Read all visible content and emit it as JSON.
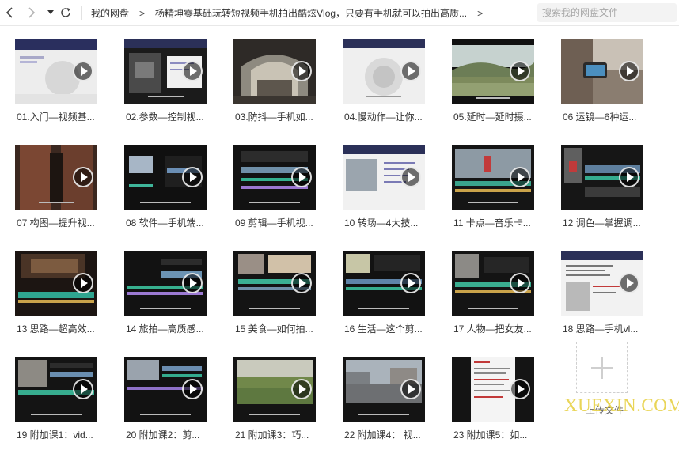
{
  "toolbar": {
    "back_icon": "chevron-left-icon",
    "forward_icon": "chevron-right-icon",
    "history_icon": "caret-down-icon",
    "refresh_icon": "refresh-icon"
  },
  "breadcrumb": {
    "root": "我的网盘",
    "separator": ">",
    "current": "杨精坤零基础玩转短视频手机拍出酷炫Vlog，只要有手机就可以拍出高质...",
    "trailing": ">"
  },
  "search": {
    "placeholder": "搜索我的网盘文件"
  },
  "files": [
    {
      "name": "01.入门—视频基..."
    },
    {
      "name": "02.参数—控制视..."
    },
    {
      "name": "03.防抖—手机如..."
    },
    {
      "name": "04.慢动作—让你..."
    },
    {
      "name": "05.延时—延时摄..."
    },
    {
      "name": "06 运镜—6种运..."
    },
    {
      "name": "07 构图—提升视..."
    },
    {
      "name": "08 软件—手机端..."
    },
    {
      "name": "09 剪辑—手机视..."
    },
    {
      "name": "10 转场—4大技..."
    },
    {
      "name": "11 卡点—音乐卡..."
    },
    {
      "name": "12 调色—掌握调..."
    },
    {
      "name": "13 思路—超高效..."
    },
    {
      "name": "14 旅拍—高质感..."
    },
    {
      "name": "15 美食—如何拍..."
    },
    {
      "name": "16 生活—这个剪..."
    },
    {
      "name": "17 人物—把女友..."
    },
    {
      "name": "18 思路—手机vl..."
    },
    {
      "name": "19 附加课1：vid..."
    },
    {
      "name": "20 附加课2：剪..."
    },
    {
      "name": "21 附加课3：巧..."
    },
    {
      "name": "22 附加课4： 视..."
    },
    {
      "name": "23 附加课5：如..."
    }
  ],
  "upload": {
    "icon": "plus-icon",
    "label": "上传文件"
  },
  "watermark": "XUEXIN.COM"
}
